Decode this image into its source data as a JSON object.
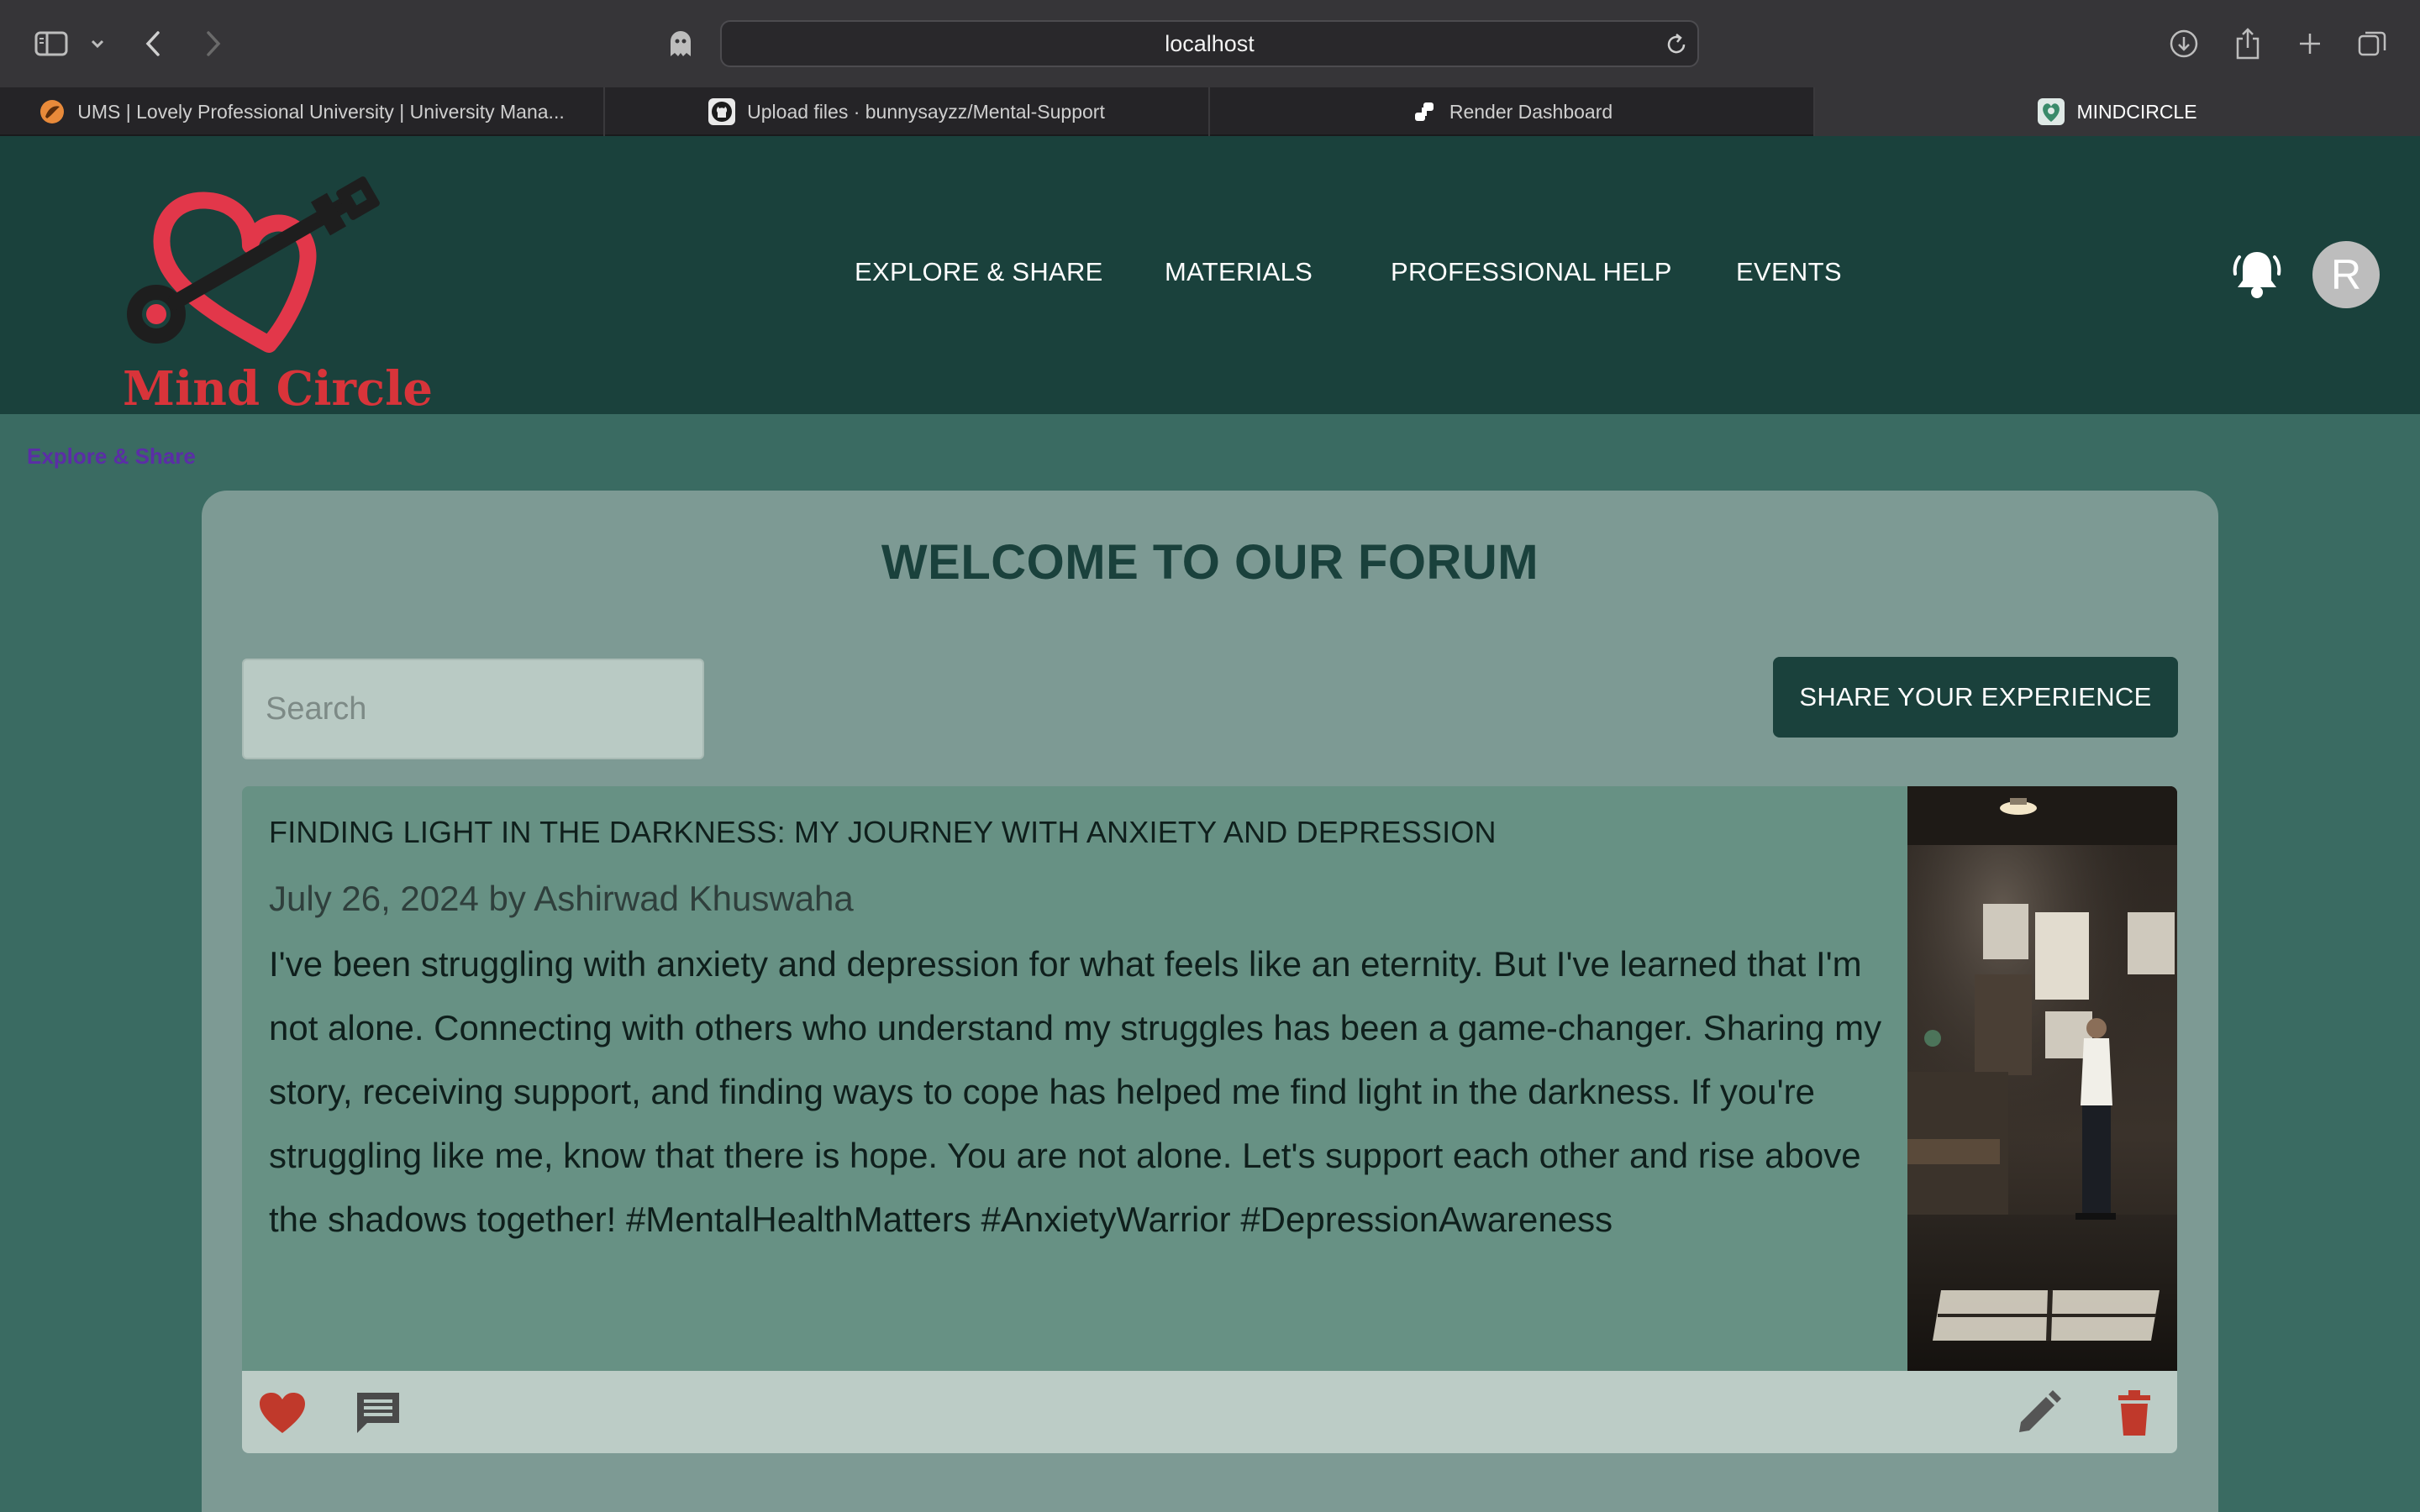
{
  "browser": {
    "url": "localhost",
    "tabs": [
      {
        "label": "UMS | Lovely Professional University | University Mana...",
        "favicon": "lpu-icon"
      },
      {
        "label": "Upload files · bunnysayzz/Mental-Support",
        "favicon": "github-icon"
      },
      {
        "label": "Render Dashboard",
        "favicon": "render-icon"
      },
      {
        "label": "MINDCIRCLE",
        "favicon": "mindcircle-icon",
        "active": true
      }
    ]
  },
  "header": {
    "logo_text": "Mind Circle",
    "nav": [
      "EXPLORE & SHARE",
      "MATERIALS",
      "PROFESSIONAL HELP",
      "EVENTS"
    ],
    "avatar_initial": "R"
  },
  "breadcrumb": "Explore & Share",
  "forum": {
    "title": "WELCOME TO OUR FORUM",
    "search_placeholder": "Search",
    "share_button": "SHARE YOUR EXPERIENCE"
  },
  "post": {
    "title": "FINDING LIGHT IN THE DARKNESS: MY JOURNEY WITH ANXIETY AND DEPRESSION",
    "meta": "July 26, 2024 by Ashirwad Khuswaha",
    "body": "I've been struggling with anxiety and depression for what feels like an eternity. But I've learned that I'm not alone. Connecting with others who understand my struggles has been a game-changer. Sharing my story, receiving support, and finding ways to cope has helped me find light in the darkness. If you're struggling like me, know that there is hope. You are not alone. Let's support each other and rise above the shadows together! #MentalHealthMatters #AnxietyWarrior #DepressionAwareness"
  },
  "colors": {
    "header_bg": "#1a413c",
    "page_bg": "#3a6b62",
    "panel_bg": "#7d9a94",
    "post_bg": "#679184",
    "accent_red": "#c0392b",
    "logo_red": "#d8343a"
  }
}
